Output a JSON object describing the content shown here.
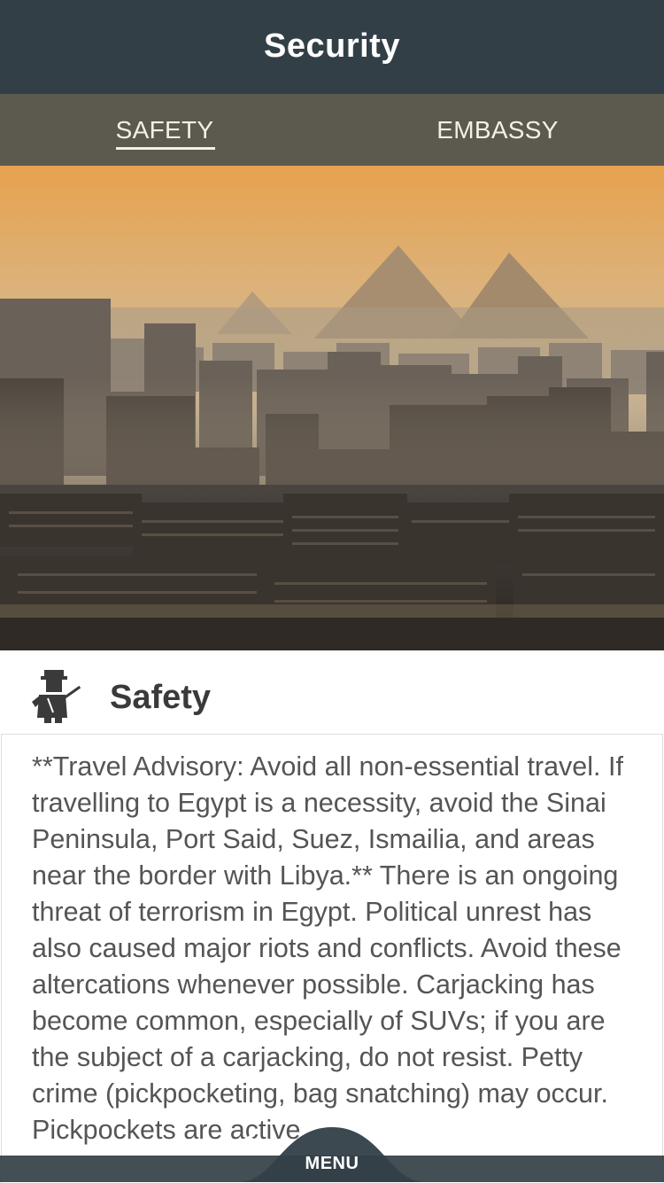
{
  "header": {
    "title": "Security"
  },
  "tabs": [
    {
      "label": "SAFETY",
      "active": true
    },
    {
      "label": "EMBASSY",
      "active": false
    }
  ],
  "section": {
    "icon": "soldier-icon",
    "title": "Safety"
  },
  "content": {
    "text": "**Travel Advisory: Avoid all non-essential travel. If travelling to Egypt is a necessity, avoid the Sinai Peninsula, Port Said, Suez, Ismailia, and areas near the border with Libya.**  There is an ongoing threat of terrorism in Egypt. Political unrest has also caused major riots and conflicts. Avoid these altercations whenever possible. Carjacking has become common, especially of SUVs; if you are the subject of a carjacking, do not resist. Petty crime (pickpocketing, bag snatching) may occur. Pickpockets are active"
  },
  "menu": {
    "label": "MENU",
    "icon": "chevron-up-icon"
  },
  "colors": {
    "header_bg": "#333f47",
    "tabs_bg": "#5c5a4f",
    "tab_text": "#f3f0e6",
    "body_text": "#555555"
  }
}
